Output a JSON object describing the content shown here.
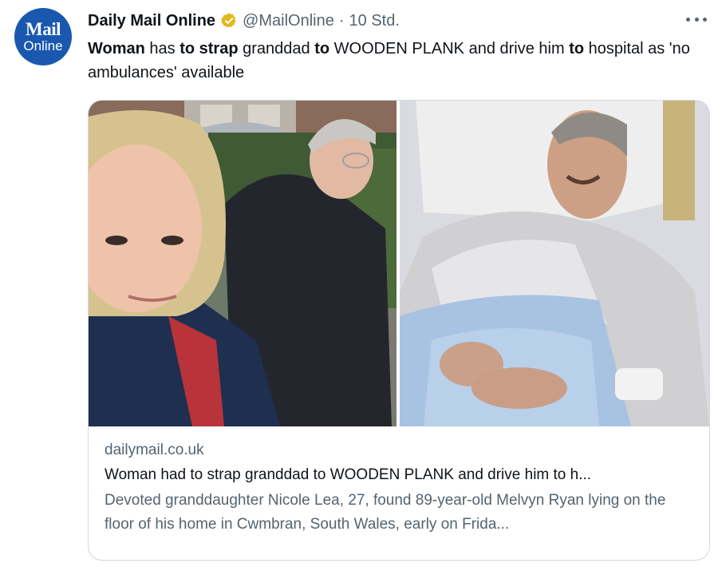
{
  "account": {
    "avatar_line1": "Mail",
    "avatar_line2": "Online",
    "name": "Daily Mail Online",
    "handle": "@MailOnline",
    "separator": "·",
    "time": "10 Std."
  },
  "tweet": {
    "seg1": "Woman",
    "seg2": " has ",
    "seg3": "to strap",
    "seg4": " granddad ",
    "seg5": "to",
    "seg6": " WOODEN PLANK and drive him ",
    "seg7": "to",
    "seg8": " hospital as 'no ambulances' available"
  },
  "card": {
    "domain": "dailymail.co.uk",
    "title": "Woman had to strap granddad to WOODEN PLANK and drive him to h...",
    "description": "Devoted granddaughter Nicole Lea, 27, found 89-year-old Melvyn Ryan lying on the floor of his home in Cwmbran, South Wales, early on Frida..."
  },
  "colors": {
    "avatar_bg": "#1a58b0",
    "verified_badge": "#e2b719",
    "text_primary": "#0f1419",
    "text_secondary": "#536471",
    "border": "#cfd9de"
  },
  "icons": {
    "verified": "verified-badge-icon",
    "more": "more-horizontal-icon"
  }
}
